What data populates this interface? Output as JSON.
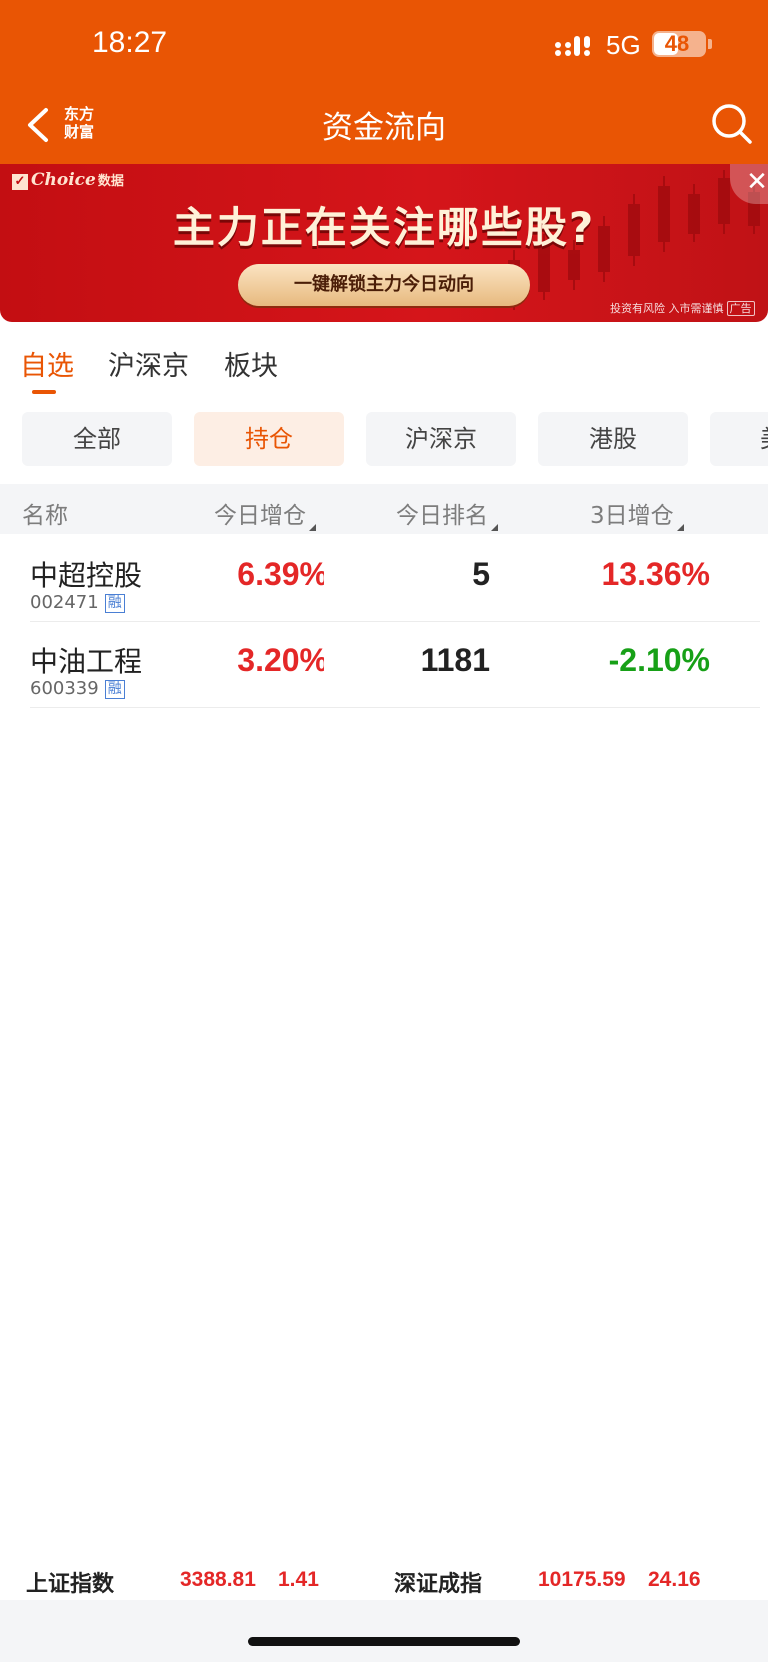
{
  "status_bar": {
    "time": "18:27",
    "network": "5G",
    "battery": "48",
    "battery_level": 0.48
  },
  "header": {
    "title": "资金流向",
    "logo_line1": "东方",
    "logo_line2": "财富",
    "back_icon": "chevron-left-icon",
    "search_icon": "search-icon",
    "bg_color": "#e95504"
  },
  "banner": {
    "brand": "Choice",
    "brand_suffix": "数据",
    "headline": "主力正在关注哪些股?",
    "cta": "一键解锁主力今日动向",
    "disclaimer": "投资有风险 入市需谨慎",
    "ad_tag": "广告",
    "close_label": "✕"
  },
  "tabs": [
    {
      "label": "自选",
      "active": true
    },
    {
      "label": "沪深京",
      "active": false
    },
    {
      "label": "板块",
      "active": false
    }
  ],
  "filters": [
    {
      "label": "全部",
      "active": false
    },
    {
      "label": "持仓",
      "active": true
    },
    {
      "label": "沪深京",
      "active": false
    },
    {
      "label": "港股",
      "active": false
    },
    {
      "label": "美",
      "active": false
    }
  ],
  "table": {
    "columns": [
      "名称",
      "今日增仓",
      "今日排名",
      "3日增仓"
    ],
    "rows": [
      {
        "name": "中超控股",
        "code": "002471",
        "tag": "融",
        "today_add": "6.39%",
        "today_rank": "5",
        "three_day_add": "13.36%",
        "three_day_color": "red"
      },
      {
        "name": "中油工程",
        "code": "600339",
        "tag": "融",
        "today_add": "3.20%",
        "today_rank": "1181",
        "three_day_add": "-2.10%",
        "three_day_color": "green"
      }
    ]
  },
  "footer": {
    "index1_name": "上证指数",
    "index1_value": "3388.81",
    "index1_change": "1.41",
    "index2_name": "深证成指",
    "index2_value": "10175.59",
    "index2_change": "24.16"
  },
  "colors": {
    "accent": "#e95504",
    "up": "#e42727",
    "down": "#17a017"
  }
}
